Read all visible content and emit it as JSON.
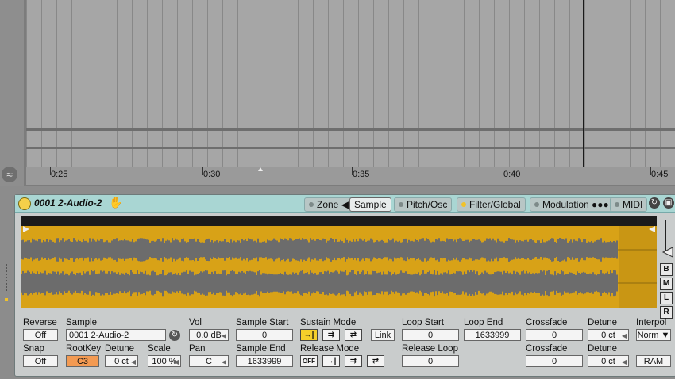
{
  "arrangement": {
    "ruler_labels": [
      "0:25",
      "0:30",
      "0:35",
      "0:40",
      "0:45"
    ]
  },
  "clip": {
    "name": "0001 2-Audio-2",
    "tabs": [
      {
        "label": "Zone",
        "active": false
      },
      {
        "label": "Sample",
        "active": true
      },
      {
        "label": "Pitch/Osc",
        "active": false
      },
      {
        "label": "Filter/Global",
        "active": false
      },
      {
        "label": "Modulation",
        "active": false
      },
      {
        "label": "MIDI",
        "active": false
      }
    ],
    "side_buttons": [
      "B",
      "M",
      "L",
      "R"
    ],
    "wave_color": "#d8a217"
  },
  "params": {
    "reverse_label": "Reverse",
    "reverse_value": "Off",
    "snap_label": "Snap",
    "snap_value": "Off",
    "sample_label": "Sample",
    "sample_value": "0001 2-Audio-2",
    "rootkey_label": "RootKey",
    "rootkey_value": "C3",
    "detune_label": "Detune",
    "detune_value": "0 ct",
    "scale_label": "Scale",
    "scale_value": "100 %",
    "vol_label": "Vol",
    "vol_value": "0.0 dB",
    "pan_label": "Pan",
    "pan_value": "C",
    "sample_start_label": "Sample Start",
    "sample_start_value": "0",
    "sample_end_label": "Sample End",
    "sample_end_value": "1633999",
    "sustain_mode_label": "Sustain Mode",
    "release_mode_label": "Release Mode",
    "release_off_label": "OFF",
    "link_label": "Link",
    "loop_start_label": "Loop Start",
    "loop_start_value": "0",
    "loop_end_label": "Loop End",
    "loop_end_value": "1633999",
    "release_loop_label": "Release Loop",
    "release_loop_value": "0",
    "crossfade1_label": "Crossfade",
    "crossfade1_value": "0",
    "crossfade2_label": "Crossfade",
    "crossfade2_value": "0",
    "detune1_label": "Detune",
    "detune1_value": "0 ct",
    "detune2_label": "Detune",
    "detune2_value": "0 ct",
    "interpol_label": "Interpol",
    "interpol_value": "Norm",
    "ram_label": "RAM"
  }
}
